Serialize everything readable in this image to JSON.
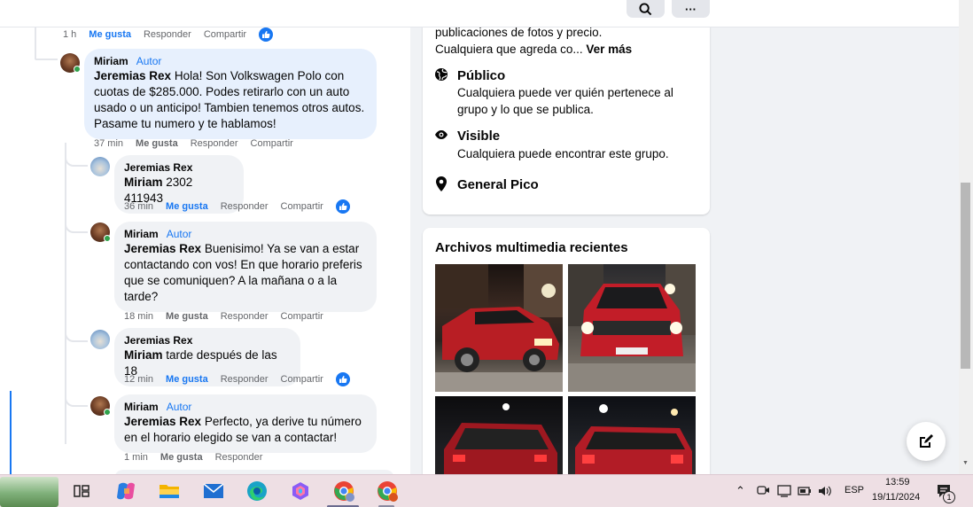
{
  "top_actions": {
    "search_icon": "search-icon",
    "more_label": "···"
  },
  "top_comment_meta": {
    "time": "1 h",
    "like": "Me gusta",
    "reply": "Responder",
    "share": "Compartir"
  },
  "comments": [
    {
      "author": "Miriam",
      "badge": "Autor",
      "mention": "Jeremias Rex",
      "text": "Hola! Son Volkswagen Polo con cuotas de $285.000. Podes retirarlo con un auto usado o un anticipo! Tambien tenemos otros autos. Pasame tu numero y te hablamos!",
      "time": "37 min",
      "like": "Me gusta",
      "reply": "Responder",
      "share": "Compartir"
    },
    {
      "author": "Jeremias Rex",
      "mention": "Miriam",
      "text": "2302 411943",
      "time": "36 min",
      "like": "Me gusta",
      "reply": "Responder",
      "share": "Compartir"
    },
    {
      "author": "Miriam",
      "badge": "Autor",
      "mention": "Jeremias Rex",
      "text": "Buenisimo! Ya se van a estar contactando con vos! En que horario preferis que se comuniquen? A la mañana o a la tarde?",
      "time": "18 min",
      "like": "Me gusta",
      "reply": "Responder",
      "share": "Compartir"
    },
    {
      "author": "Jeremias Rex",
      "mention": "Miriam",
      "text": "tarde después de las 18",
      "time": "12 min",
      "like": "Me gusta",
      "reply": "Responder",
      "share": "Compartir"
    },
    {
      "author": "Miriam",
      "badge": "Autor",
      "mention": "Jeremias Rex",
      "text": "Perfecto, ya derive tu número en el horario elegido se van a contactar!",
      "time": "1 min",
      "like": "Me gusta",
      "reply": "Responder"
    }
  ],
  "about": {
    "desc_line1": "publicaciones de fotos y precio.",
    "desc_line2": "Cualquiera que agreda co...",
    "see_more": "Ver más",
    "items": [
      {
        "icon": "globe-icon",
        "title": "Público",
        "desc": "Cualquiera puede ver quién pertenece al grupo y lo que se publica."
      },
      {
        "icon": "eye-icon",
        "title": "Visible",
        "desc": "Cualquiera puede encontrar este grupo."
      },
      {
        "icon": "location-pin-icon",
        "title": "General Pico"
      }
    ]
  },
  "media": {
    "title": "Archivos multimedia recientes",
    "photos": [
      "red-pickup-truck-night-side",
      "red-pickup-truck-night-front",
      "red-pickup-truck-night-rear",
      "red-pickup-truck-night-rear-2"
    ]
  },
  "taskbar": {
    "apps": [
      "widgets-landscape-icon",
      "task-view-icon",
      "copilot-icon",
      "file-explorer-icon",
      "mail-icon",
      "edge-icon",
      "microsoft365-icon",
      "chrome-profile-icon",
      "chrome-icon"
    ],
    "tray": {
      "language": "ESP",
      "time": "13:59",
      "date": "19/11/2024",
      "notifications": "1"
    }
  },
  "colors": {
    "brand": "#1877f2",
    "highlight_bubble": "#e7f0fd",
    "bubble": "#f0f2f5",
    "online": "#31a24c"
  }
}
